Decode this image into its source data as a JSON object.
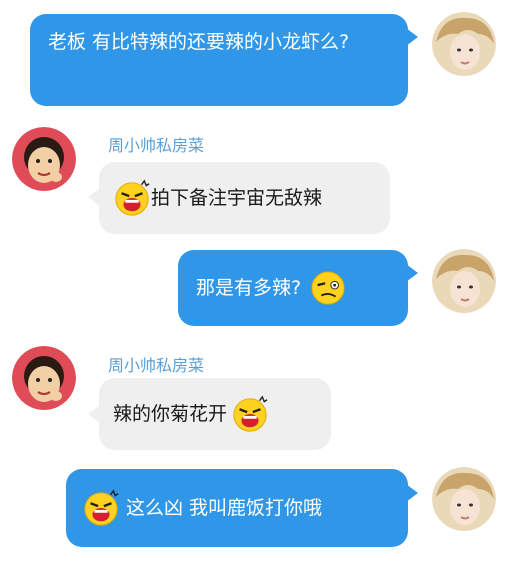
{
  "contact": {
    "name": "周小帅私房菜"
  },
  "messages": [
    {
      "side": "right",
      "text": "老板 有比特辣的还要辣的小龙虾么?"
    },
    {
      "side": "left",
      "sender": "周小帅私房菜",
      "emoji": "shouting-face-icon",
      "text": "拍下备注宇宙无敌辣"
    },
    {
      "side": "right",
      "text": "那是有多辣?",
      "emoji": "squinting-face-icon"
    },
    {
      "side": "left",
      "sender": "周小帅私房菜",
      "text": "辣的你菊花开",
      "emoji": "shouting-face-icon"
    },
    {
      "side": "right",
      "emoji": "shouting-face-icon",
      "text": "这么凶 我叫鹿饭打你哦"
    }
  ],
  "colors": {
    "right_bubble": "#2f96e8",
    "left_bubble": "#efefef",
    "sender_name": "#5a9fd6"
  }
}
